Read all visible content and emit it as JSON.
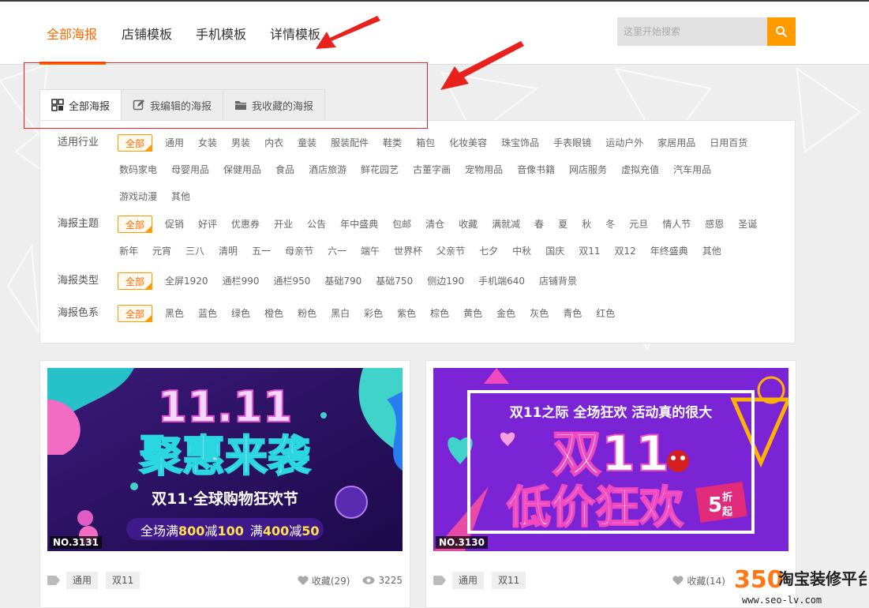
{
  "header": {
    "tabs": [
      {
        "label": "全部海报",
        "active": true
      },
      {
        "label": "店铺模板",
        "active": false
      },
      {
        "label": "手机模板",
        "active": false
      },
      {
        "label": "详情模板",
        "active": false
      }
    ],
    "search_placeholder": "这里开始搜索"
  },
  "subtabs": [
    {
      "label": "全部海报",
      "icon": "grid-icon",
      "active": true
    },
    {
      "label": "我编辑的海报",
      "icon": "edit-icon",
      "active": false
    },
    {
      "label": "我收藏的海报",
      "icon": "folder-icon",
      "active": false
    }
  ],
  "filters": {
    "industry": {
      "label": "适用行业",
      "items": [
        "全部",
        "通用",
        "女装",
        "男装",
        "内衣",
        "童装",
        "服装配件",
        "鞋类",
        "箱包",
        "化妆美容",
        "珠宝饰品",
        "手表眼镜",
        "运动户外",
        "家居用品",
        "日用百货",
        "数码家电",
        "母婴用品",
        "保健用品",
        "食品",
        "酒店旅游",
        "鲜花园艺",
        "古董字画",
        "宠物用品",
        "音像书籍",
        "网店服务",
        "虚拟充值",
        "汽车用品",
        "游戏动漫",
        "其他"
      ]
    },
    "theme": {
      "label": "海报主题",
      "items": [
        "全部",
        "促销",
        "好评",
        "优惠券",
        "开业",
        "公告",
        "年中盛典",
        "包邮",
        "清仓",
        "收藏",
        "满就减",
        "春",
        "夏",
        "秋",
        "冬",
        "元旦",
        "情人节",
        "感恩",
        "圣诞",
        "新年",
        "元宵",
        "三八",
        "清明",
        "五一",
        "母亲节",
        "六一",
        "端午",
        "世界杯",
        "父亲节",
        "七夕",
        "中秋",
        "国庆",
        "双11",
        "双12",
        "年终盛典",
        "其他"
      ]
    },
    "type": {
      "label": "海报类型",
      "items": [
        "全部",
        "全屏1920",
        "通栏990",
        "通栏950",
        "基础790",
        "基础750",
        "侧边190",
        "手机端640",
        "店铺背景"
      ]
    },
    "color": {
      "label": "海报色系",
      "items": [
        "全部",
        "黑色",
        "蓝色",
        "绿色",
        "橙色",
        "粉色",
        "黑白",
        "彩色",
        "紫色",
        "棕色",
        "黄色",
        "金色",
        "灰色",
        "青色",
        "红色"
      ]
    }
  },
  "cards": [
    {
      "number": "NO.3131",
      "poster": {
        "line1": "11.11",
        "line2": "聚惠来袭",
        "line3": "双11·全球购物狂欢节",
        "line4a": "全场满",
        "n1": "800",
        "line4b": "减",
        "n2": "100",
        "line4c": "满",
        "n3": "400",
        "line4d": "减",
        "n4": "50"
      },
      "tags": [
        "通用",
        "双11"
      ],
      "favorites": "收藏(29)",
      "views": "3225"
    },
    {
      "number": "NO.3130",
      "poster": {
        "line1": "双11之际 全场狂欢 活动真的很大",
        "line2": "双11",
        "line3": "低价狂欢",
        "badge_num": "5",
        "badge_a": "折",
        "badge_b": "起"
      },
      "tags": [
        "通用",
        "双11"
      ],
      "favorites": "收藏(14)",
      "views": ""
    }
  ],
  "watermark": {
    "num": "350",
    "name": "淘宝装修平台",
    "url": "www.seo-lv.com"
  },
  "colors": {
    "accent": "#ff6a00",
    "search_btn": "#ff9b00",
    "annotation": "#e8211d"
  }
}
